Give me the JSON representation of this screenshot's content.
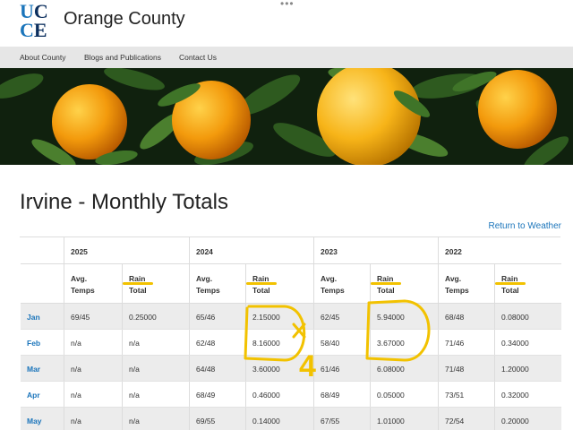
{
  "header": {
    "logo": {
      "u": "U",
      "c1": "C",
      "c2": "C",
      "e": "E"
    },
    "title": "Orange County",
    "more_glyph": "•••"
  },
  "nav": {
    "items": [
      "About County",
      "Blogs and Publications",
      "Contact Us"
    ]
  },
  "page": {
    "title": "Irvine - Monthly Totals",
    "return_link": "Return to Weather"
  },
  "table": {
    "years": [
      "2025",
      "2024",
      "2023",
      "2022"
    ],
    "sub_headers": {
      "temps_line1": "Avg.",
      "temps_line2": "Temps",
      "rain_line1": "Rain",
      "rain_line2": "Total"
    },
    "rows": [
      {
        "month": "Jan",
        "values": [
          "69/45",
          "0.25000",
          "65/46",
          "2.15000",
          "62/45",
          "5.94000",
          "68/48",
          "0.08000"
        ]
      },
      {
        "month": "Feb",
        "values": [
          "n/a",
          "n/a",
          "62/48",
          "8.16000",
          "58/40",
          "3.67000",
          "71/46",
          "0.34000"
        ]
      },
      {
        "month": "Mar",
        "values": [
          "n/a",
          "n/a",
          "64/48",
          "3.60000",
          "61/46",
          "6.08000",
          "71/48",
          "1.20000"
        ]
      },
      {
        "month": "Apr",
        "values": [
          "n/a",
          "n/a",
          "68/49",
          "0.46000",
          "68/49",
          "0.05000",
          "73/51",
          "0.32000"
        ]
      },
      {
        "month": "May",
        "values": [
          "n/a",
          "n/a",
          "69/55",
          "0.14000",
          "67/55",
          "1.01000",
          "72/54",
          "0.20000"
        ]
      }
    ]
  },
  "annotation": {
    "handwritten_digit": "4",
    "color": "#f2c200"
  },
  "colors": {
    "accent": "#1b75bb",
    "nav_bg": "#e6e6e6",
    "row_shade": "#ececec",
    "highlight": "#f2c200"
  }
}
